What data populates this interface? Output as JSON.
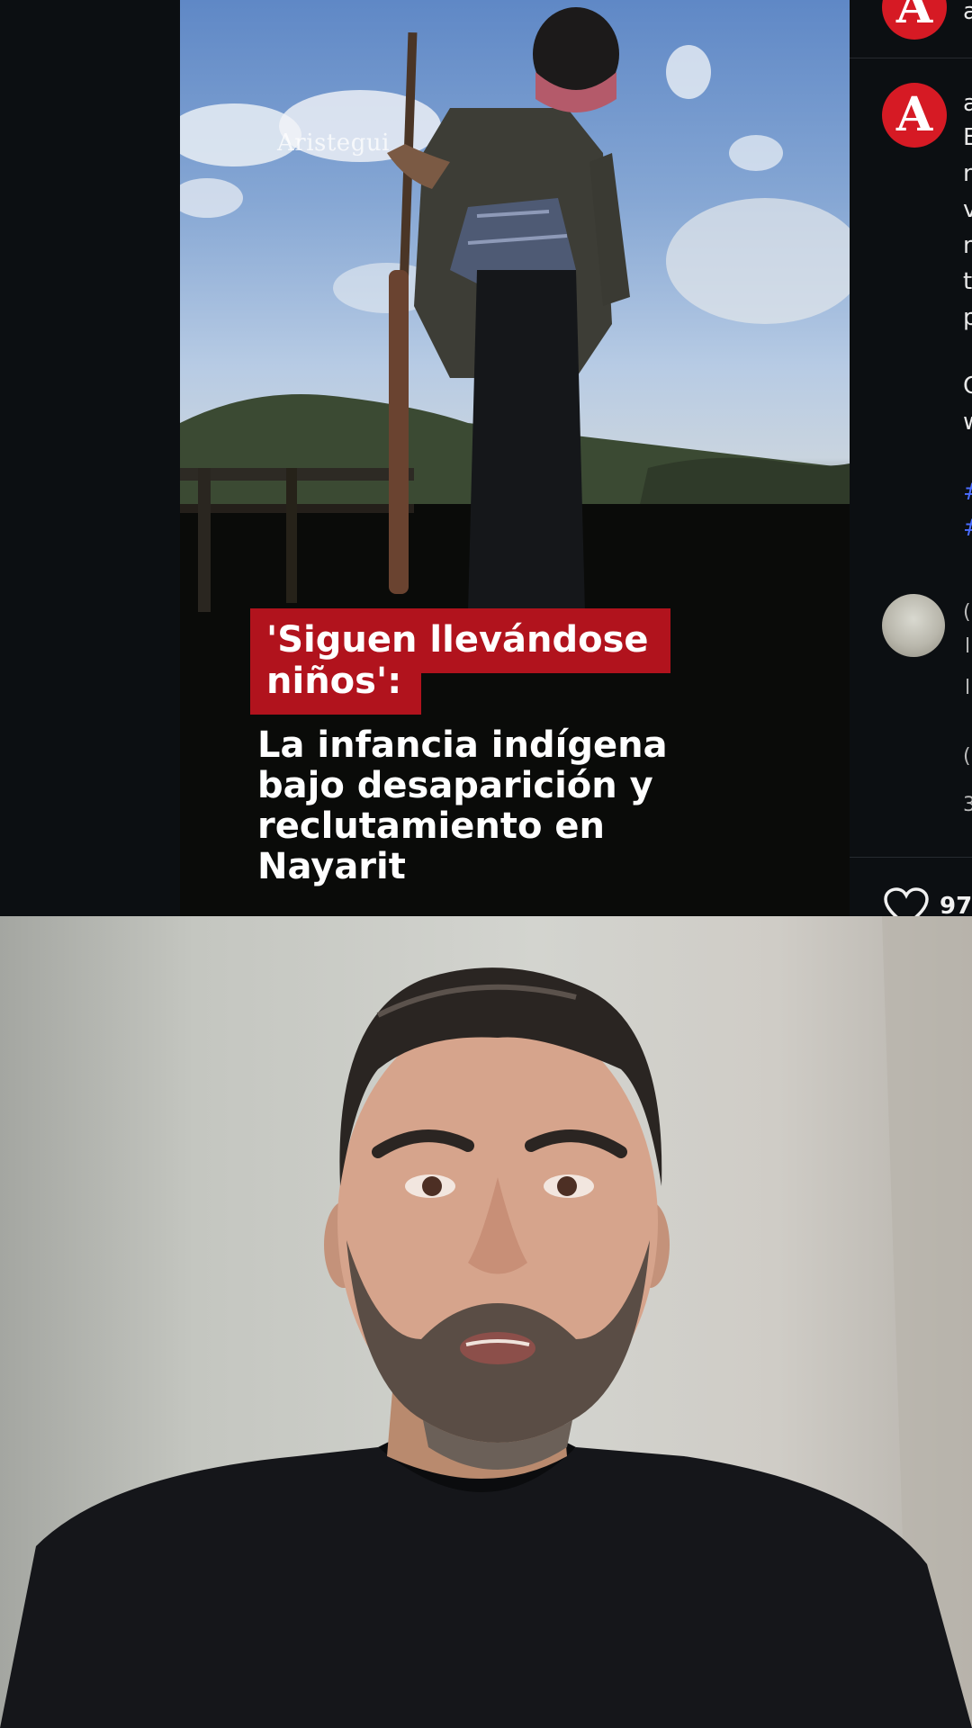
{
  "post": {
    "watermark": "Aristegui",
    "headline": "'Siguen llevándose niños':",
    "subheadline": "La infancia indígena bajo desaparición y reclutamiento en Nayarit",
    "brand_color": "#b1131d"
  },
  "side_panel": {
    "avatar_letter": "A",
    "header_fragment": "a",
    "caption_fragments": [
      "a",
      "E",
      "n",
      "v",
      "n",
      "t",
      "p",
      "C",
      "w"
    ],
    "hashtag_fragments": [
      "#",
      "#"
    ],
    "comment_fragments": [
      "(",
      "l",
      "l",
      "(",
      "3"
    ],
    "like_count_fragment": "97"
  },
  "icons": {
    "heart": "heart-icon",
    "avatar": "avatar-icon"
  }
}
